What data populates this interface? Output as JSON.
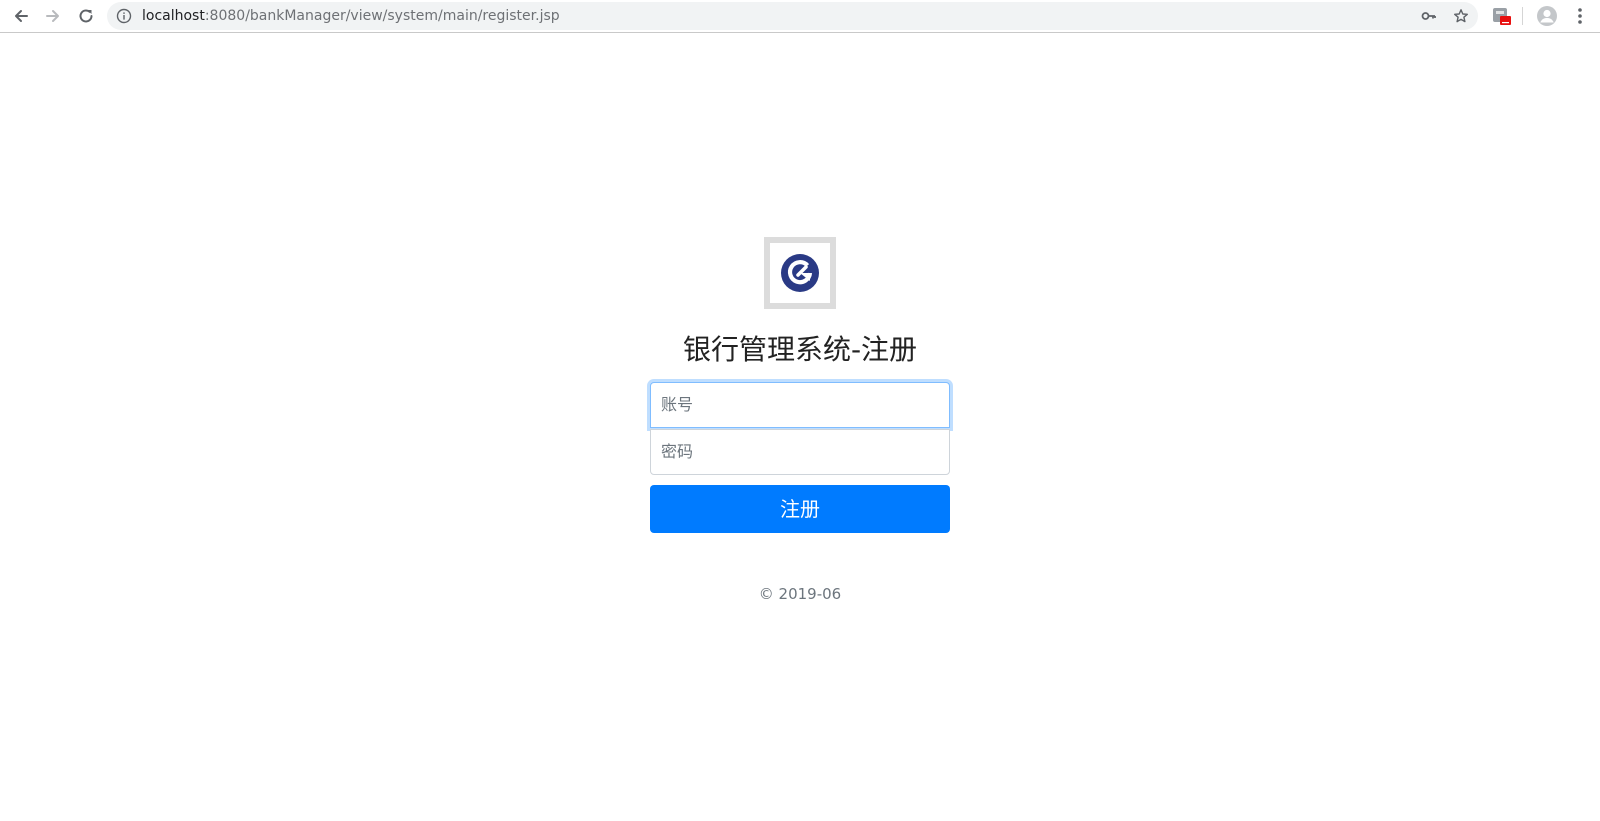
{
  "browser": {
    "url_host": "localhost",
    "url_rest": ":8080/bankManager/view/system/main/register.jsp",
    "icons": {
      "back": "arrow-left-icon",
      "forward": "arrow-right-icon",
      "reload": "reload-icon",
      "info": "info-icon",
      "key": "key-icon",
      "bookmark": "star-icon",
      "extension": "extension-icon",
      "profile": "profile-icon",
      "menu": "more-vert-icon"
    }
  },
  "page": {
    "logo": "bank-logo",
    "title": "银行管理系统-注册",
    "account_placeholder": "账号",
    "password_placeholder": "密码",
    "submit_label": "注册",
    "footer": "© 2019-06"
  },
  "colors": {
    "primary": "#007bff",
    "logo_blue": "#2a3a85",
    "focus_border": "#80bdff"
  }
}
